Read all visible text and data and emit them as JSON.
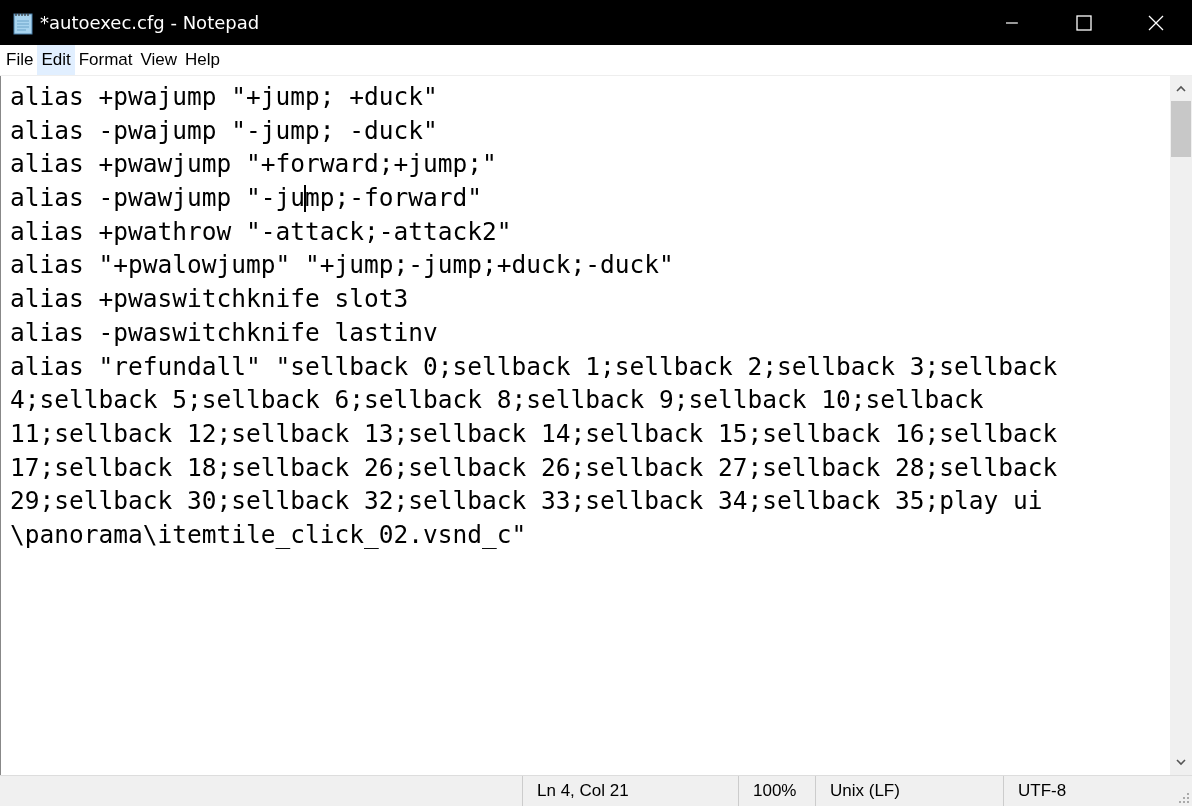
{
  "window": {
    "title": "*autoexec.cfg - Notepad"
  },
  "menu": [
    {
      "label": "File",
      "selected": false
    },
    {
      "label": "Edit",
      "selected": true
    },
    {
      "label": "Format",
      "selected": false
    },
    {
      "label": "View",
      "selected": false
    },
    {
      "label": "Help",
      "selected": false
    }
  ],
  "editor": {
    "lines": [
      {
        "text": "alias +pwajump \"+jump; +duck\""
      },
      {
        "text": "alias -pwajump \"-jump; -duck\""
      },
      {
        "text": "alias +pwawjump \"+forward;+jump;\""
      },
      {
        "before_caret": "alias -pwawjump \"-ju",
        "after_caret": "mp;-forward\""
      },
      {
        "text": "alias +pwathrow \"-attack;-attack2\""
      },
      {
        "text": "alias \"+pwalowjump\" \"+jump;-jump;+duck;-duck\""
      },
      {
        "text": "alias +pwaswitchknife slot3"
      },
      {
        "text": "alias -pwaswitchknife lastinv"
      },
      {
        "text": "alias \"refundall\" \"sellback 0;sellback 1;sellback 2;sellback 3;sellback"
      },
      {
        "text": "4;sellback 5;sellback 6;sellback 8;sellback 9;sellback 10;sellback"
      },
      {
        "text": "11;sellback 12;sellback 13;sellback 14;sellback 15;sellback 16;sellback"
      },
      {
        "text": "17;sellback 18;sellback 26;sellback 26;sellback 27;sellback 28;sellback"
      },
      {
        "text": "29;sellback 30;sellback 32;sellback 33;sellback 34;sellback 35;play ui"
      },
      {
        "text": "\\panorama\\itemtile_click_02.vsnd_c\""
      }
    ]
  },
  "status_bar": {
    "position": "Ln 4, Col 21",
    "zoom": "100%",
    "line_ending": "Unix (LF)",
    "encoding": "UTF-8"
  }
}
